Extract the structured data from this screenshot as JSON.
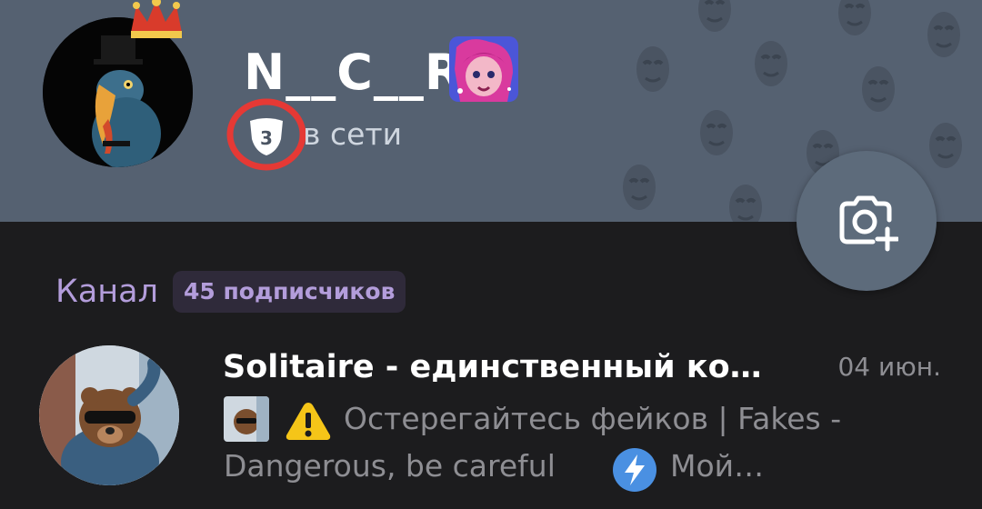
{
  "profile": {
    "name": "N__C__R",
    "level": "3",
    "presence": "в сети"
  },
  "channel_section": {
    "label": "Канал",
    "subscribers": "45 подписчиков"
  },
  "channel": {
    "title": "Solitaire - единственный ко…",
    "date": "04 июн.",
    "preview_line1": "Остерегайтесь фейков | Fakes -",
    "preview_line2a": "Dangerous, be careful",
    "preview_line2b": "Мой…"
  },
  "colors": {
    "header_bg": "#556171",
    "page_bg": "#1c1c1e",
    "accent_purple": "#b39ddb",
    "highlight_ring": "#e53935",
    "warning_yellow": "#f5c518",
    "flash_blue": "#4a90e2"
  },
  "icons": {
    "camera": "camera-add-icon",
    "warning": "warning-icon",
    "flash": "flash-icon",
    "level": "shield-level-icon"
  }
}
